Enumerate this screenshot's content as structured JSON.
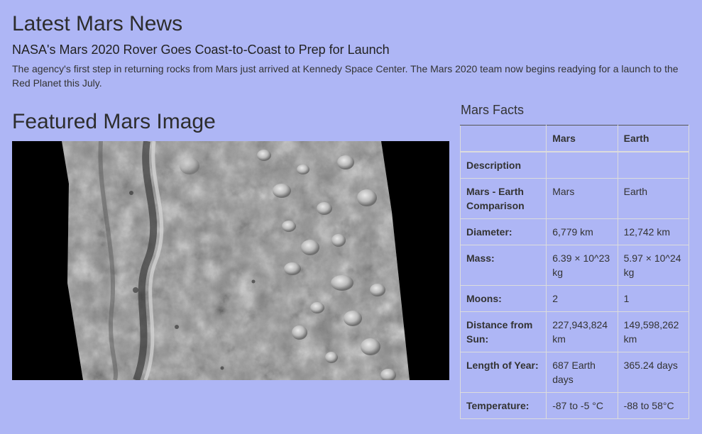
{
  "news": {
    "section_title": "Latest Mars News",
    "headline": "NASA's Mars 2020 Rover Goes Coast-to-Coast to Prep for Launch",
    "teaser": "The agency's first step in returning rocks from Mars just arrived at Kennedy Space Center. The Mars 2020 team now begins readying for a launch to the Red Planet this July."
  },
  "featured": {
    "section_title": "Featured Mars Image"
  },
  "facts": {
    "section_title": "Mars Facts",
    "columns": [
      "",
      "Mars",
      "Earth"
    ],
    "rows": [
      {
        "label": "Description",
        "mars": "",
        "earth": ""
      },
      {
        "label": "Mars - Earth Comparison",
        "mars": "Mars",
        "earth": "Earth"
      },
      {
        "label": "Diameter:",
        "mars": "6,779 km",
        "earth": "12,742 km"
      },
      {
        "label": "Mass:",
        "mars": "6.39 × 10^23 kg",
        "earth": "5.97 × 10^24 kg"
      },
      {
        "label": "Moons:",
        "mars": "2",
        "earth": "1"
      },
      {
        "label": "Distance from Sun:",
        "mars": "227,943,824 km",
        "earth": "149,598,262 km"
      },
      {
        "label": "Length of Year:",
        "mars": "687 Earth days",
        "earth": "365.24 days"
      },
      {
        "label": "Temperature:",
        "mars": "-87 to -5 °C",
        "earth": "-88 to 58°C"
      }
    ]
  },
  "colors": {
    "background": "#aeb6f5",
    "text": "#333333"
  }
}
